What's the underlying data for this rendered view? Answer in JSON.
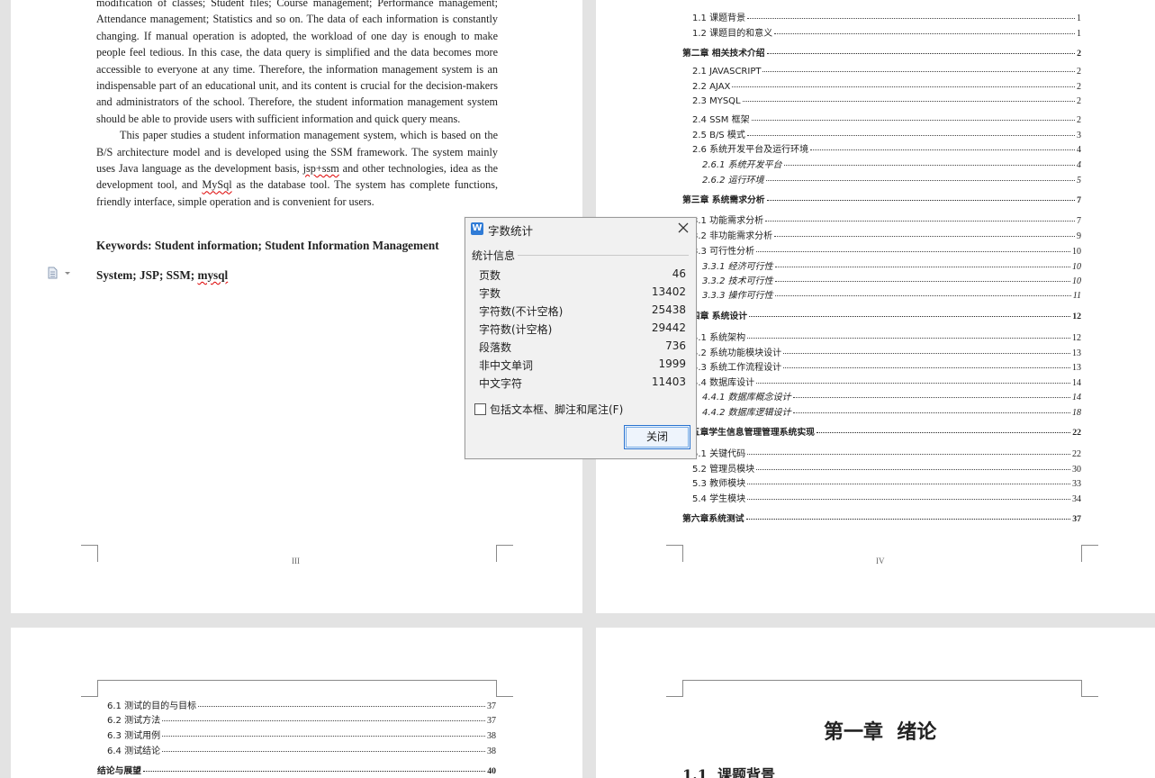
{
  "page_top_left": {
    "para1": "modification of classes; Student files; Course management; Performance management; Attendance management; Statistics and so on. The data of each information is constantly changing. If manual operation is adopted, the workload of one day is enough to make people feel tedious. In this case, the data query is simplified and the data becomes more accessible to everyone at any time. Therefore, the information management system is an indispensable part of an educational unit, and its content is crucial for the decision-makers and administrators of the school. Therefore, the student information management system should be able to provide users with sufficient information and quick query means.",
    "para2_a": "This paper studies a student information management system, which is based on the B/S architecture model and is developed using the SSM framework. The system mainly uses Java language as the development basis, ",
    "para2_b": "jsp+ssm",
    "para2_c": " and other technologies, idea as the development tool, and ",
    "para2_d": "MySql",
    "para2_e": " as the database tool. The system has complete functions, friendly interface, simple operation and is convenient for users.",
    "keywords_line1": "Keywords: Student information; Student Information Management",
    "keywords_line2_a": "System; JSP; SSM; ",
    "keywords_line2_b": "mysql",
    "page_number": "III"
  },
  "page_top_right": {
    "page_number": "IV",
    "toc": [
      {
        "text": "1.1 课题背景",
        "page": "1"
      },
      {
        "text": "1.2 课题目的和意义",
        "page": "1"
      },
      {
        "text": "第二章  相关技术介绍",
        "page": "2"
      },
      {
        "text": "2.1 JAVASCRIPT",
        "page": "2"
      },
      {
        "text": "2.2 AJAX",
        "page": "2"
      },
      {
        "text": "2.3 MYSQL",
        "page": "2"
      },
      {
        "text": "2.4 SSM 框架",
        "page": "2"
      },
      {
        "text": "2.5 B/S 模式",
        "page": "3"
      },
      {
        "text": "2.6 系统开发平台及运行环境",
        "page": "4"
      },
      {
        "text": "2.6.1  系统开发平台",
        "page": "4"
      },
      {
        "text": "2.6.2  运行环境",
        "page": "5"
      },
      {
        "text": "第三章  系统需求分析",
        "page": "7"
      },
      {
        "text": "3.1 功能需求分析",
        "page": "7"
      },
      {
        "text": "3.2 非功能需求分析",
        "page": "9"
      },
      {
        "text": "3.3 可行性分析",
        "page": "10"
      },
      {
        "text": "3.3.1  经济可行性",
        "page": "10"
      },
      {
        "text": "3.3.2  技术可行性",
        "page": "10"
      },
      {
        "text": "3.3.3  操作可行性",
        "page": "11"
      },
      {
        "text": "第四章  系统设计",
        "page": "12"
      },
      {
        "text": "4.1 系统架构",
        "page": "12"
      },
      {
        "text": "4.2 系统功能模块设计",
        "page": "13"
      },
      {
        "text": "4.3 系统工作流程设计",
        "page": "13"
      },
      {
        "text": "4.4 数据库设计",
        "page": "14"
      },
      {
        "text": "4.4.1  数据库概念设计",
        "page": "14"
      },
      {
        "text": "4.4.2  数据库逻辑设计",
        "page": "18"
      },
      {
        "text": "第五章学生信息管理管理系统实现",
        "page": "22"
      },
      {
        "text": "5.1 关键代码",
        "page": "22"
      },
      {
        "text": "5.2 管理员模块",
        "page": "30"
      },
      {
        "text": "5.3 教师模块",
        "page": "33"
      },
      {
        "text": "5.4 学生模块",
        "page": "34"
      },
      {
        "text": "第六章系统测试",
        "page": "37"
      }
    ]
  },
  "page_bottom_left": {
    "toc": [
      {
        "text": "6.1 测试的目的与目标",
        "page": "37"
      },
      {
        "text": "6.2 测试方法",
        "page": "37"
      },
      {
        "text": "6.3 测试用例",
        "page": "38"
      },
      {
        "text": "6.4 测试结论",
        "page": "38"
      },
      {
        "text": "结论与展望",
        "page": "40"
      }
    ]
  },
  "page_bottom_right": {
    "chapter_title": "第一章  绪论",
    "section_title": "1.1  课题背景"
  },
  "dialog": {
    "title": "字数统计",
    "group_label": "统计信息",
    "stats": [
      {
        "label": "页数",
        "value": "46"
      },
      {
        "label": "字数",
        "value": "13402"
      },
      {
        "label": "字符数(不计空格)",
        "value": "25438"
      },
      {
        "label": "字符数(计空格)",
        "value": "29442"
      },
      {
        "label": "段落数",
        "value": "736"
      },
      {
        "label": "非中文单词",
        "value": "1999"
      },
      {
        "label": "中文字符",
        "value": "11403"
      }
    ],
    "checkbox_label": "包括文本框、脚注和尾注(F)",
    "close_button": "关闭",
    "accent": "#2a73d0"
  }
}
